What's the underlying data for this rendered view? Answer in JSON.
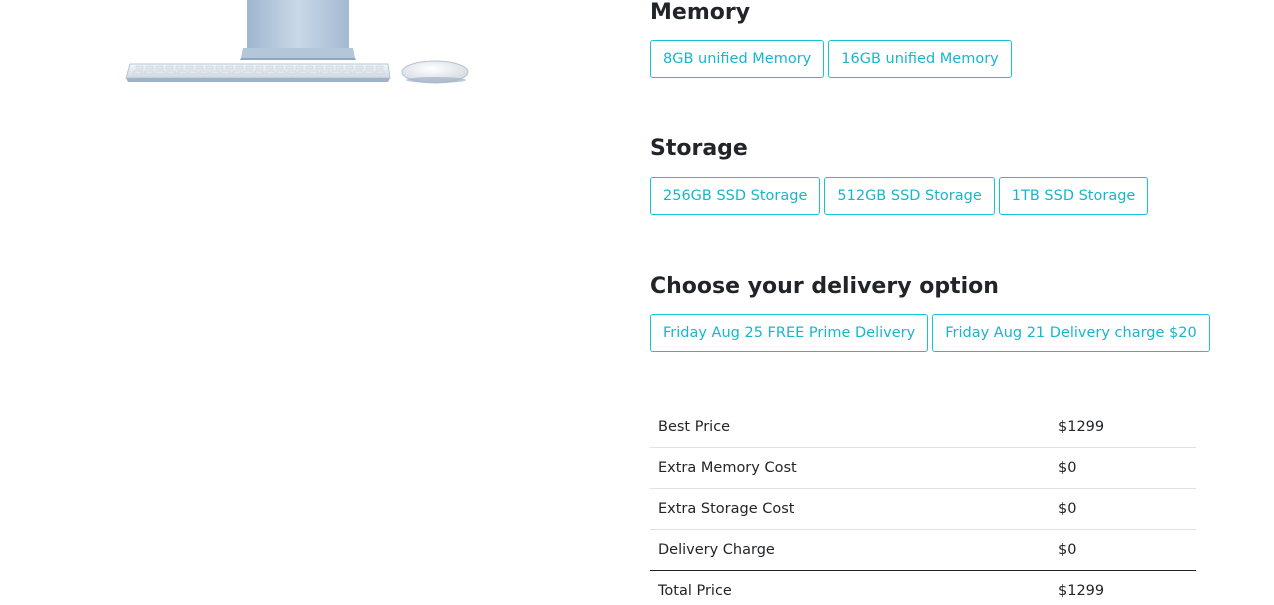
{
  "memory": {
    "title": "Memory",
    "options": [
      "8GB unified Memory",
      "16GB unified Memory"
    ]
  },
  "storage": {
    "title": "Storage",
    "options": [
      "256GB SSD Storage",
      "512GB SSD Storage",
      "1TB SSD Storage"
    ]
  },
  "delivery": {
    "title": "Choose your delivery option",
    "options": [
      "Friday Aug 25 FREE Prime Delivery",
      "Friday Aug 21 Delivery charge $20"
    ]
  },
  "pricing": {
    "rows": [
      {
        "label": "Best Price",
        "value": "$1299"
      },
      {
        "label": "Extra Memory Cost",
        "value": "$0"
      },
      {
        "label": "Extra Storage Cost",
        "value": "$0"
      },
      {
        "label": "Delivery Charge",
        "value": "$0"
      },
      {
        "label": "Total Price",
        "value": "$1299"
      }
    ]
  },
  "colors": {
    "accent": "#17c1d6",
    "text": "#212529"
  }
}
